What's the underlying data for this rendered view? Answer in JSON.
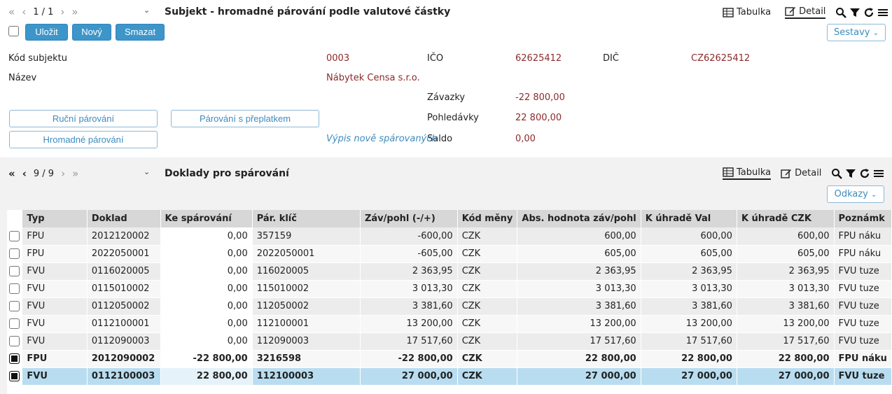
{
  "top": {
    "pager": "1 / 1",
    "title": "Subjekt - hromadné párování podle valutové částky",
    "view_table": "Tabulka",
    "view_detail": "Detail",
    "save": "Uložit",
    "new": "Nový",
    "delete": "Smazat",
    "reports": "Sestavy"
  },
  "detail": {
    "kod_label": "Kód subjektu",
    "kod_value": "0003",
    "ico_label": "IČO",
    "ico_value": "62625412",
    "dic_label": "DIČ",
    "dic_value": "CZ62625412",
    "nazev_label": "Název",
    "nazev_value": "Nábytek Censa s.r.o.",
    "zavazky_label": "Závazky",
    "zavazky_value": "-22 800,00",
    "pohledavky_label": "Pohledávky",
    "pohledavky_value": "22 800,00",
    "saldo_label": "Saldo",
    "saldo_value": "0,00",
    "btn_manual": "Ruční párování",
    "btn_overpay": "Párování s přeplatkem",
    "btn_bulk": "Hromadné párování",
    "link_list": "Výpis nově spárovaných"
  },
  "bottom": {
    "pager": "9 / 9",
    "title": "Doklady pro spárování",
    "view_table": "Tabulka",
    "view_detail": "Detail",
    "links": "Odkazy"
  },
  "grid": {
    "headers": [
      "Typ",
      "Doklad",
      "Ke spárování",
      "Pár. klíč",
      "Záv/pohl (-/+)",
      "Kód měny",
      "Abs. hodnota záv/pohl",
      "K úhradě Val",
      "K úhradě CZK",
      "Poznámk"
    ],
    "rows": [
      {
        "typ": "FPU",
        "doklad": "2012120002",
        "ke": "0,00",
        "klic": "357159",
        "zp": "-600,00",
        "mena": "CZK",
        "abs": "600,00",
        "val": "600,00",
        "czk": "600,00",
        "pozn": "FPU náku",
        "checked": false
      },
      {
        "typ": "FPU",
        "doklad": "2022050001",
        "ke": "0,00",
        "klic": "2022050001",
        "zp": "-605,00",
        "mena": "CZK",
        "abs": "605,00",
        "val": "605,00",
        "czk": "605,00",
        "pozn": "FPU náku",
        "checked": false
      },
      {
        "typ": "FVU",
        "doklad": "0116020005",
        "ke": "0,00",
        "klic": "116020005",
        "zp": "2 363,95",
        "mena": "CZK",
        "abs": "2 363,95",
        "val": "2 363,95",
        "czk": "2 363,95",
        "pozn": "FVU tuze",
        "checked": false
      },
      {
        "typ": "FVU",
        "doklad": "0115010002",
        "ke": "0,00",
        "klic": "115010002",
        "zp": "3 013,30",
        "mena": "CZK",
        "abs": "3 013,30",
        "val": "3 013,30",
        "czk": "3 013,30",
        "pozn": "FVU tuze",
        "checked": false
      },
      {
        "typ": "FVU",
        "doklad": "0112050002",
        "ke": "0,00",
        "klic": "112050002",
        "zp": "3 381,60",
        "mena": "CZK",
        "abs": "3 381,60",
        "val": "3 381,60",
        "czk": "3 381,60",
        "pozn": "FVU tuze",
        "checked": false
      },
      {
        "typ": "FVU",
        "doklad": "0112100001",
        "ke": "0,00",
        "klic": "112100001",
        "zp": "13 200,00",
        "mena": "CZK",
        "abs": "13 200,00",
        "val": "13 200,00",
        "czk": "13 200,00",
        "pozn": "FVU tuze",
        "checked": false
      },
      {
        "typ": "FVU",
        "doklad": "0112090003",
        "ke": "0,00",
        "klic": "112090003",
        "zp": "17 517,60",
        "mena": "CZK",
        "abs": "17 517,60",
        "val": "17 517,60",
        "czk": "17 517,60",
        "pozn": "FVU tuze",
        "checked": false
      },
      {
        "typ": "FPU",
        "doklad": "2012090002",
        "ke": "-22 800,00",
        "klic": "3216598",
        "zp": "-22 800,00",
        "mena": "CZK",
        "abs": "22 800,00",
        "val": "22 800,00",
        "czk": "22 800,00",
        "pozn": "FPU náku",
        "checked": true
      },
      {
        "typ": "FVU",
        "doklad": "0112100003",
        "ke": "22 800,00",
        "klic": "112100003",
        "zp": "27 000,00",
        "mena": "CZK",
        "abs": "27 000,00",
        "val": "27 000,00",
        "czk": "27 000,00",
        "pozn": "FVU tuze",
        "checked": true
      }
    ]
  }
}
